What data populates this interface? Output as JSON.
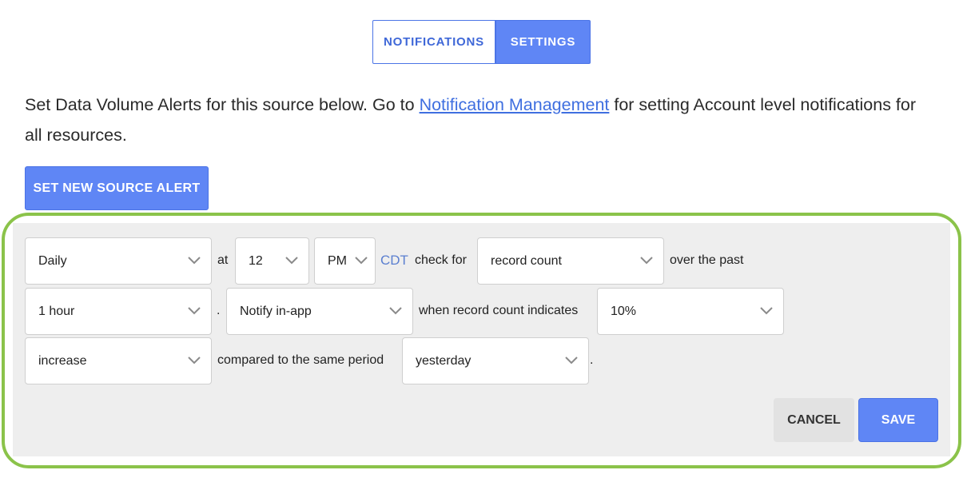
{
  "tabs": {
    "notifications": "NOTIFICATIONS",
    "settings": "SETTINGS"
  },
  "intro": {
    "before_link": "Set Data Volume Alerts for this source below. Go to ",
    "link": "Notification Management",
    "after_link": " for setting Account level notifications for all resources."
  },
  "new_alert_button": "SET NEW SOURCE ALERT",
  "form": {
    "frequency": "Daily",
    "at_label": "at",
    "hour": "12",
    "ampm": "PM",
    "timezone": "CDT",
    "check_for_label": "check for",
    "metric": "record count",
    "over_label": "over the past",
    "period": "1 hour",
    "period_dot": ".",
    "notify": "Notify in-app",
    "indicates_label": "when record count indicates",
    "threshold": "10%",
    "direction": "increase",
    "compared_label": "compared to the same period",
    "comparison": "yesterday",
    "end_dot": "."
  },
  "actions": {
    "cancel": "CANCEL",
    "save": "SAVE"
  },
  "colors": {
    "accent": "#5f86f5",
    "highlight": "#8bc34a",
    "panel_bg": "#eeeeee",
    "link": "#3f6fe0"
  }
}
